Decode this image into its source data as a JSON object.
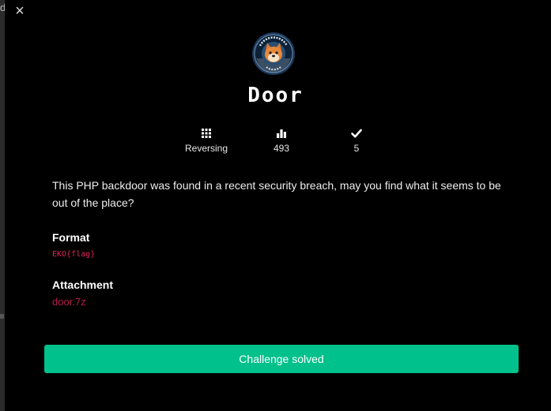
{
  "modal": {
    "close_symbol": "×"
  },
  "challenge": {
    "logo_icon": "team-badge-icon",
    "title": "Door",
    "stats": {
      "category": "Reversing",
      "points": "493",
      "solves": "5"
    },
    "description": "This PHP backdoor was found in a recent security breach, may you find what it seems to be out of the place?",
    "format_label": "Format",
    "format_value": "EKO{flag}",
    "attachment_label": "Attachment",
    "attachment_file": "door.7z",
    "status_button": "Challenge solved"
  },
  "colors": {
    "background": "#000000",
    "accent_green": "#00c08b",
    "flag_pink": "#e0245e",
    "link_red": "#b81b4a"
  },
  "icons": {
    "category": "grid-icon",
    "points": "bar-chart-icon",
    "solves": "checkmark-icon"
  }
}
